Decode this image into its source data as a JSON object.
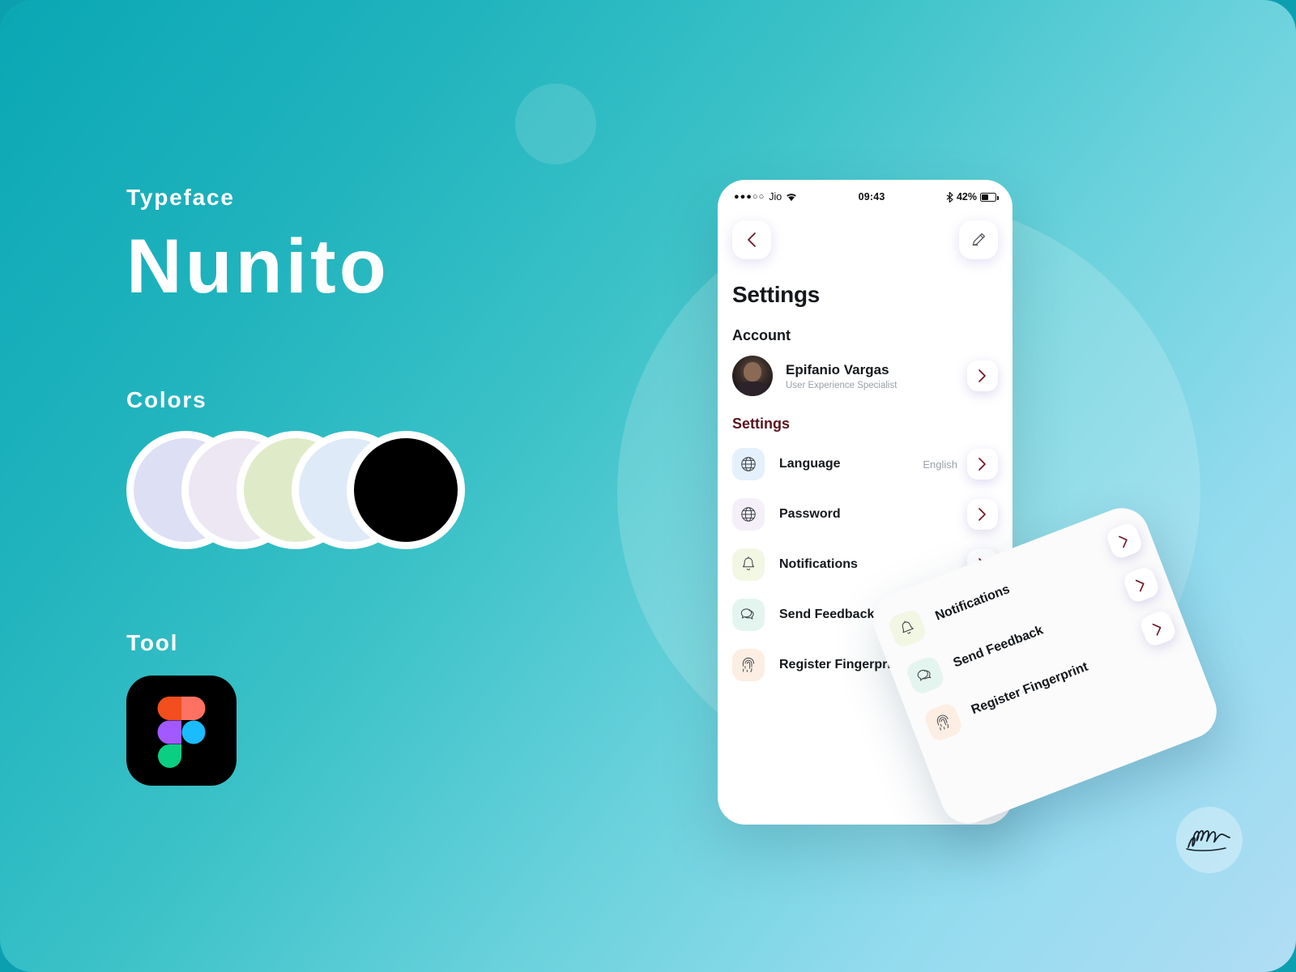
{
  "meta": {
    "background_gradient_from": "#0aa7b4",
    "background_gradient_to": "#b0ddf5"
  },
  "left_panel": {
    "typeface_label": "Typeface",
    "typeface_name": "Nunito",
    "colors_label": "Colors",
    "swatches": [
      {
        "name": "lavender-blue",
        "hex": "#DDDFF5"
      },
      {
        "name": "light-lilac",
        "hex": "#EDE7F4"
      },
      {
        "name": "light-green",
        "hex": "#DFEBC8"
      },
      {
        "name": "light-blue",
        "hex": "#DEEAF8"
      },
      {
        "name": "black",
        "hex": "#000000"
      }
    ],
    "tool_label": "Tool",
    "tool_name": "Figma",
    "figma_colors": {
      "orange": "#F24E1E",
      "salmon": "#FF7262",
      "purple": "#A259FF",
      "blue": "#1ABCFE",
      "green": "#0ACF83"
    }
  },
  "phone": {
    "status_bar": {
      "signal_dots": "●●●○○",
      "carrier": "Jio",
      "wifi_icon": "wifi-icon",
      "time": "09:43",
      "bluetooth_icon": "bluetooth-icon",
      "battery_percent": "42%",
      "battery_icon": "battery-icon"
    },
    "nav": {
      "back_icon": "chevron-left-icon",
      "edit_icon": "pencil-icon"
    },
    "title": "Settings",
    "account_section": {
      "heading": "Account",
      "user_name": "Epifanio Vargas",
      "user_role": "User Experience Specialist",
      "chevron_icon": "chevron-right-icon"
    },
    "settings_section": {
      "heading": "Settings",
      "heading_color": "#5b1420",
      "items": [
        {
          "label": "Language",
          "value": "English",
          "icon": "globe-icon",
          "icon_bg": "#E4F0FB"
        },
        {
          "label": "Password",
          "value": "",
          "icon": "globe-icon",
          "icon_bg": "#F4EFF8"
        },
        {
          "label": "Notifications",
          "value": "",
          "icon": "bell-icon",
          "icon_bg": "#F2F7E4"
        },
        {
          "label": "Send Feedback",
          "value": "",
          "icon": "chat-bubble-icon",
          "icon_bg": "#E4F5EF"
        },
        {
          "label": "Register Fingerprint",
          "value": "",
          "icon": "fingerprint-icon",
          "icon_bg": "#FCEEE3"
        }
      ]
    }
  },
  "floating_card": {
    "items": [
      {
        "label": "Notifications",
        "icon": "bell-icon",
        "icon_bg": "#F2F7E4"
      },
      {
        "label": "Send Feedback",
        "icon": "chat-bubble-icon",
        "icon_bg": "#E4F5EF"
      },
      {
        "label": "Register Fingerprint",
        "icon": "fingerprint-icon",
        "icon_bg": "#FCEEE3"
      }
    ],
    "chevron_icon": "chevron-right-icon"
  },
  "signature": {
    "name": "Lisa Nico"
  }
}
